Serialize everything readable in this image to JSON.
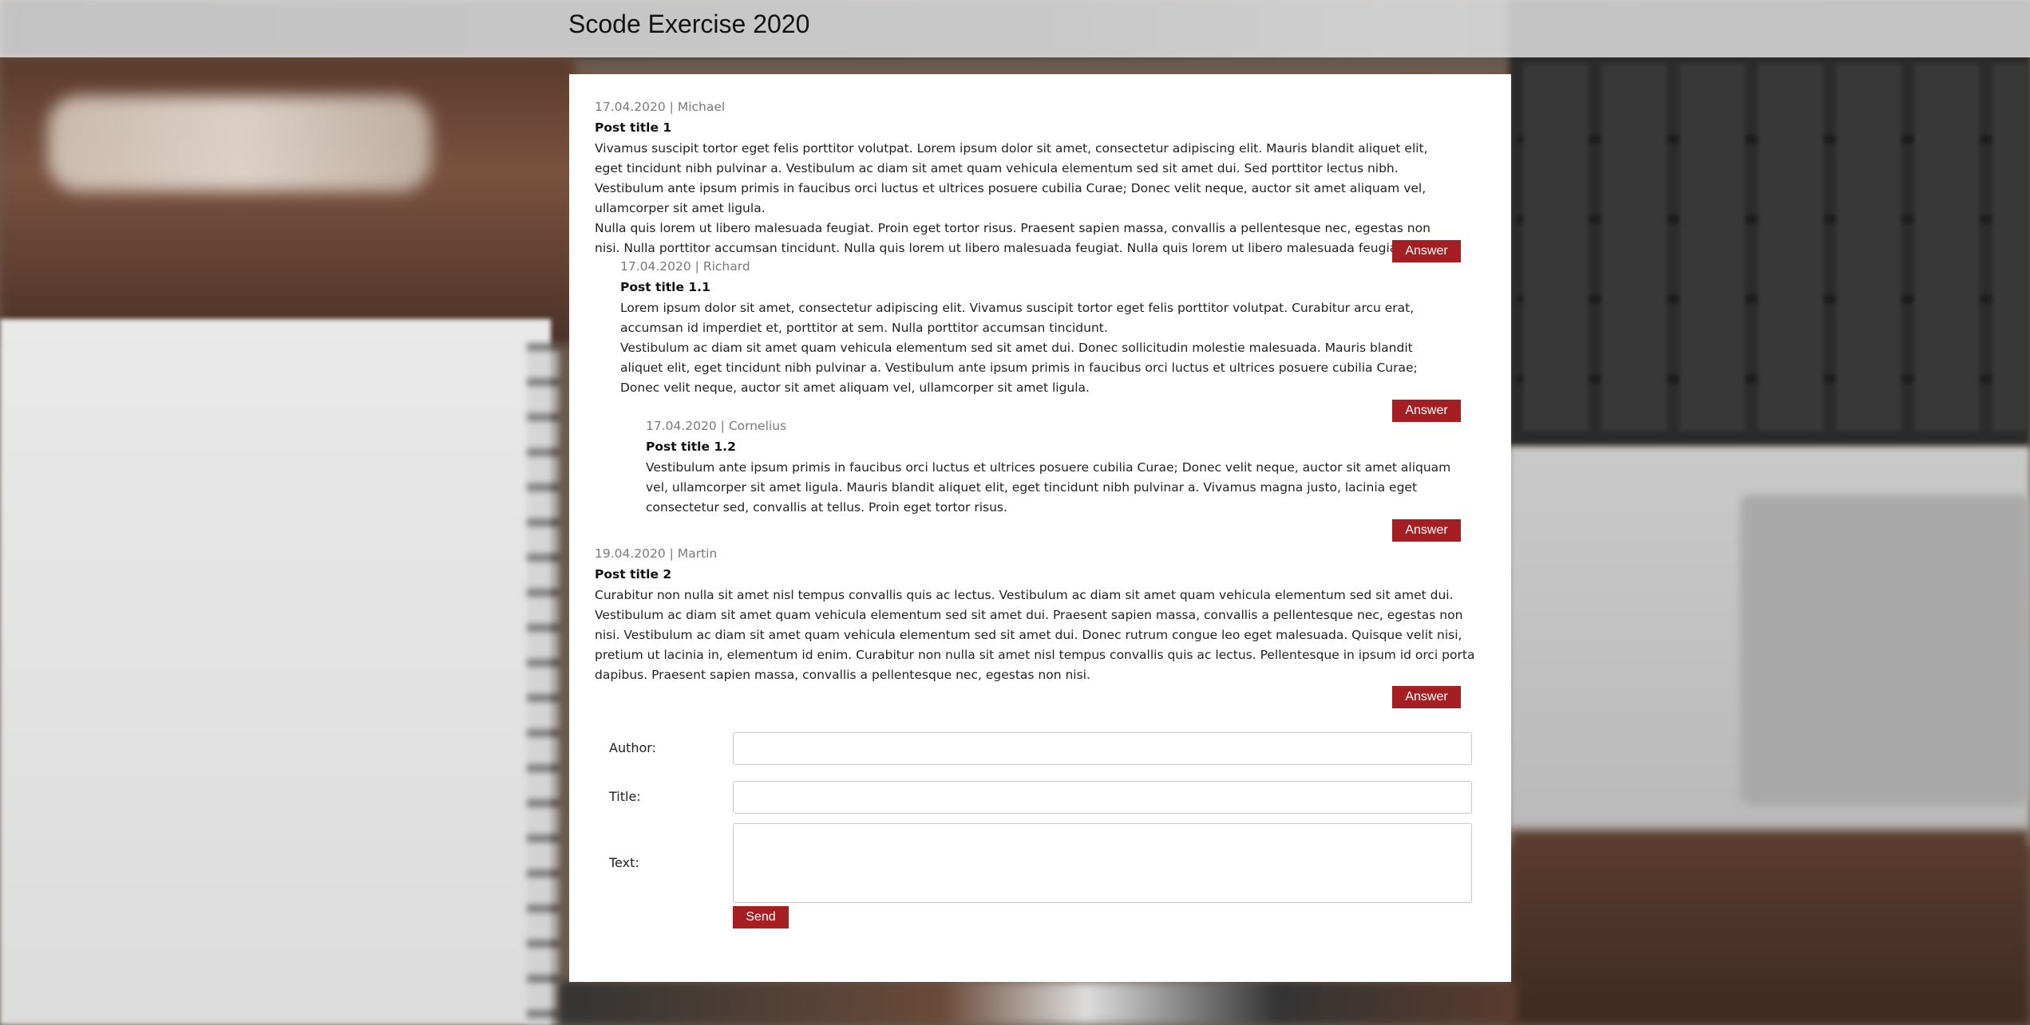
{
  "header": {
    "title": "Scode Exercise 2020"
  },
  "posts": [
    {
      "meta": "17.04.2020 | Michael",
      "title": "Post title 1",
      "paragraphs": [
        "Vivamus suscipit tortor eget felis porttitor volutpat. Lorem ipsum dolor sit amet, consectetur adipiscing elit. Mauris blandit aliquet elit, eget tincidunt nibh pulvinar a. Vestibulum ac diam sit amet quam vehicula elementum sed sit amet dui. Sed porttitor lectus nibh. Vestibulum ante ipsum primis in faucibus orci luctus et ultrices posuere cubilia Curae; Donec velit neque, auctor sit amet aliquam vel, ullamcorper sit amet ligula.",
        "Nulla quis lorem ut libero malesuada feugiat. Proin eget tortor risus. Praesent sapien massa, convallis a pellentesque nec, egestas non nisi. Nulla porttitor accumsan tincidunt. Nulla quis lorem ut libero malesuada feugiat. Nulla quis lorem ut libero malesuada feugiat."
      ],
      "answer_label": "Answer"
    },
    {
      "meta": "17.04.2020 | Richard",
      "title": "Post title 1.1",
      "paragraphs": [
        "Lorem ipsum dolor sit amet, consectetur adipiscing elit. Vivamus suscipit tortor eget felis porttitor volutpat. Curabitur arcu erat, accumsan id imperdiet et, porttitor at sem. Nulla porttitor accumsan tincidunt.",
        "Vestibulum ac diam sit amet quam vehicula elementum sed sit amet dui. Donec sollicitudin molestie malesuada. Mauris blandit aliquet elit, eget tincidunt nibh pulvinar a. Vestibulum ante ipsum primis in faucibus orci luctus et ultrices posuere cubilia Curae; Donec velit neque, auctor sit amet aliquam vel, ullamcorper sit amet ligula."
      ],
      "answer_label": "Answer"
    },
    {
      "meta": "17.04.2020 | Cornelius",
      "title": "Post title 1.2",
      "paragraphs": [
        "Vestibulum ante ipsum primis in faucibus orci luctus et ultrices posuere cubilia Curae; Donec velit neque, auctor sit amet aliquam vel, ullamcorper sit amet ligula. Mauris blandit aliquet elit, eget tincidunt nibh pulvinar a. Vivamus magna justo, lacinia eget consectetur sed, convallis at tellus. Proin eget tortor risus."
      ],
      "answer_label": "Answer"
    },
    {
      "meta": "19.04.2020 | Martin",
      "title": "Post title 2",
      "paragraphs": [
        "Curabitur non nulla sit amet nisl tempus convallis quis ac lectus. Vestibulum ac diam sit amet quam vehicula elementum sed sit amet dui. Vestibulum ac diam sit amet quam vehicula elementum sed sit amet dui. Praesent sapien massa, convallis a pellentesque nec, egestas non nisi. Vestibulum ac diam sit amet quam vehicula elementum sed sit amet dui. Donec rutrum congue leo eget malesuada. Quisque velit nisi, pretium ut lacinia in, elementum id enim. Curabitur non nulla sit amet nisl tempus convallis quis ac lectus. Pellentesque in ipsum id orci porta dapibus. Praesent sapien massa, convallis a pellentesque nec, egestas non nisi."
      ],
      "answer_label": "Answer"
    }
  ],
  "form": {
    "author_label": "Author:",
    "author_value": "",
    "title_label": "Title:",
    "title_value": "",
    "text_label": "Text:",
    "text_value": "",
    "send_label": "Send"
  },
  "colors": {
    "accent": "#a51f22",
    "card_bg": "#ffffff",
    "meta_text": "#7a7a7a"
  }
}
